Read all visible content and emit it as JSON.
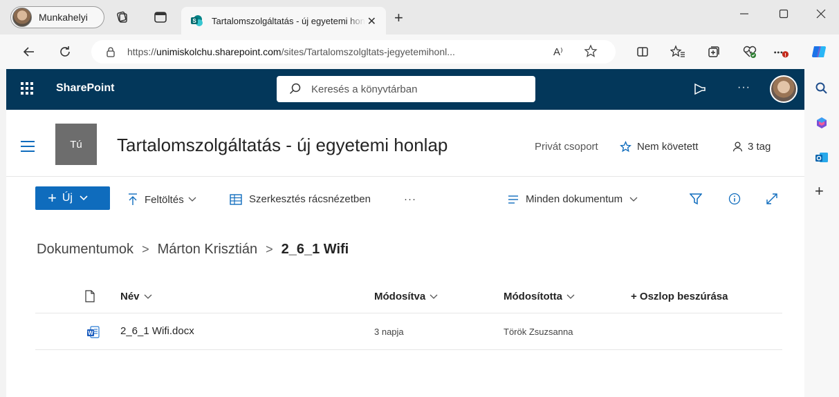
{
  "browser": {
    "profile_label": "Munkahelyi",
    "tab_title": "Tartalomszolgáltatás - új egyetemi honlap",
    "url_prefix": "https://",
    "url_host": "unimiskolchu.sharepoint.com",
    "url_path": "/sites/Tartalomszolgltats-jegyetemihonl...",
    "read_aloud": "A⁾",
    "accent": "#0f6cbd"
  },
  "suite": {
    "brand": "SharePoint",
    "search_placeholder": "Keresés a könyvtárban",
    "bar_color": "#03375a",
    "more_label": "···"
  },
  "site": {
    "logo_initials": "Tú",
    "title": "Tartalomszolgáltatás - új egyetemi honlap",
    "privacy": "Privát csoport",
    "follow_label": "Nem követett",
    "members_label": "3 tag"
  },
  "commands": {
    "new_label": "Új",
    "upload_label": "Feltöltés",
    "grid_edit_label": "Szerkesztés rácsnézetben",
    "more_label": "···",
    "view_label": "Minden dokumentum"
  },
  "breadcrumb": {
    "items": [
      "Dokumentumok",
      "Márton Krisztián"
    ],
    "current": "2_6_1 Wifi",
    "separator": ">"
  },
  "doclist": {
    "columns": {
      "name": "Név",
      "modified": "Módosítva",
      "modified_by": "Módosította",
      "add_column": "+ Oszlop beszúrása"
    },
    "rows": [
      {
        "name": "2_6_1 Wifi.docx",
        "modified": "3 napja",
        "modified_by": "Török Zsuzsanna",
        "icon": "word-icon"
      }
    ]
  }
}
